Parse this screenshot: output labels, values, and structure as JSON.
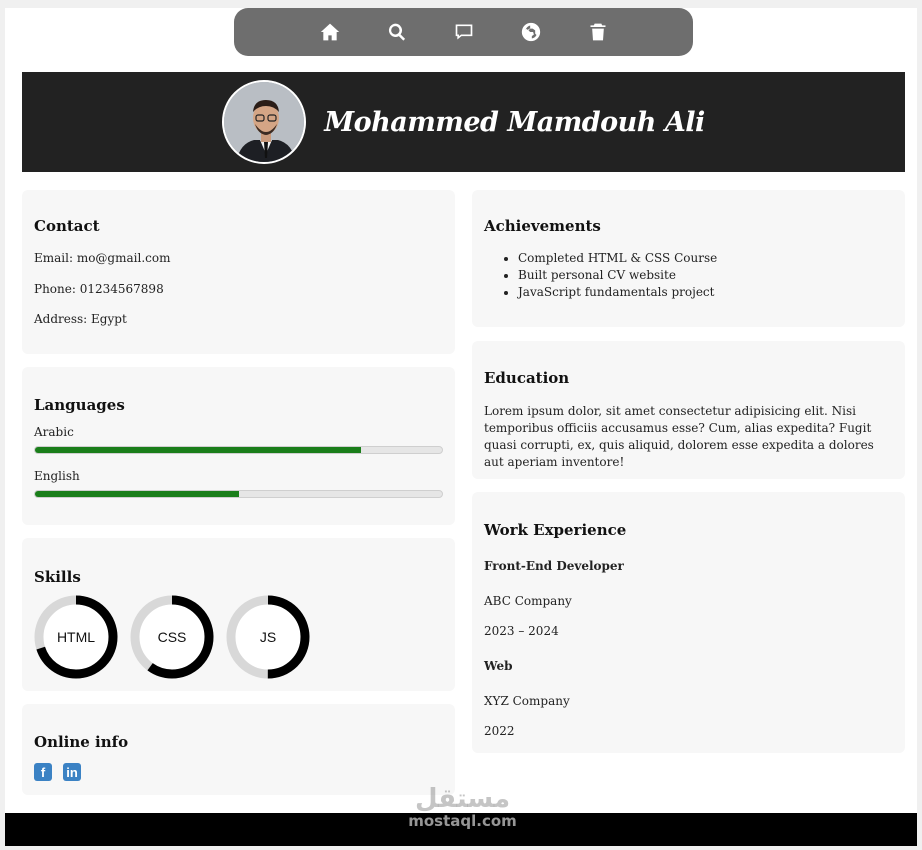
{
  "nav": {
    "items": [
      {
        "icon": "home-icon"
      },
      {
        "icon": "search-icon"
      },
      {
        "icon": "comment-icon"
      },
      {
        "icon": "globe-icon"
      },
      {
        "icon": "trash-icon"
      }
    ]
  },
  "header": {
    "name": "Mohammed Mamdouh Ali"
  },
  "contact": {
    "title": "Contact",
    "email": "Email: mo@gmail.com",
    "phone": "Phone: 01234567898",
    "address": "Address: Egypt"
  },
  "languages": {
    "title": "Languages",
    "items": [
      {
        "label": "Arabic",
        "level": 0.8
      },
      {
        "label": "English",
        "level": 0.5
      }
    ]
  },
  "skills": {
    "title": "Skills",
    "items": [
      {
        "label": "HTML",
        "level": 0.7
      },
      {
        "label": "CSS",
        "level": 0.6
      },
      {
        "label": "JS",
        "level": 0.5
      }
    ]
  },
  "online": {
    "title": "Online info",
    "links": [
      {
        "icon": "facebook-icon"
      },
      {
        "icon": "linkedin-icon"
      }
    ]
  },
  "achievements": {
    "title": "Achievements",
    "items": [
      "Completed HTML & CSS Course",
      "Built personal CV website",
      "JavaScript fundamentals project"
    ]
  },
  "education": {
    "title": "Education",
    "text": "Lorem ipsum dolor, sit amet consectetur adipisicing elit. Nisi temporibus officiis accusamus esse? Cum, alias expedita? Fugit quasi corrupti, ex, quis aliquid, dolorem esse expedita a dolores aut aperiam inventore!"
  },
  "work": {
    "title": "Work Experience",
    "jobs": [
      {
        "role": "Front-End Developer",
        "company": "ABC Company",
        "period": "2023 – 2024"
      },
      {
        "role": "Web",
        "company": "XYZ Company",
        "period": "2022"
      }
    ]
  },
  "watermark": {
    "arabic": "مستقل",
    "site": "mostaql.com"
  },
  "colors": {
    "nav": "#6e6e6e",
    "header": "#222222",
    "bar": "#1a7e1a",
    "ring": "#000000",
    "card": "#f7f7f7"
  }
}
